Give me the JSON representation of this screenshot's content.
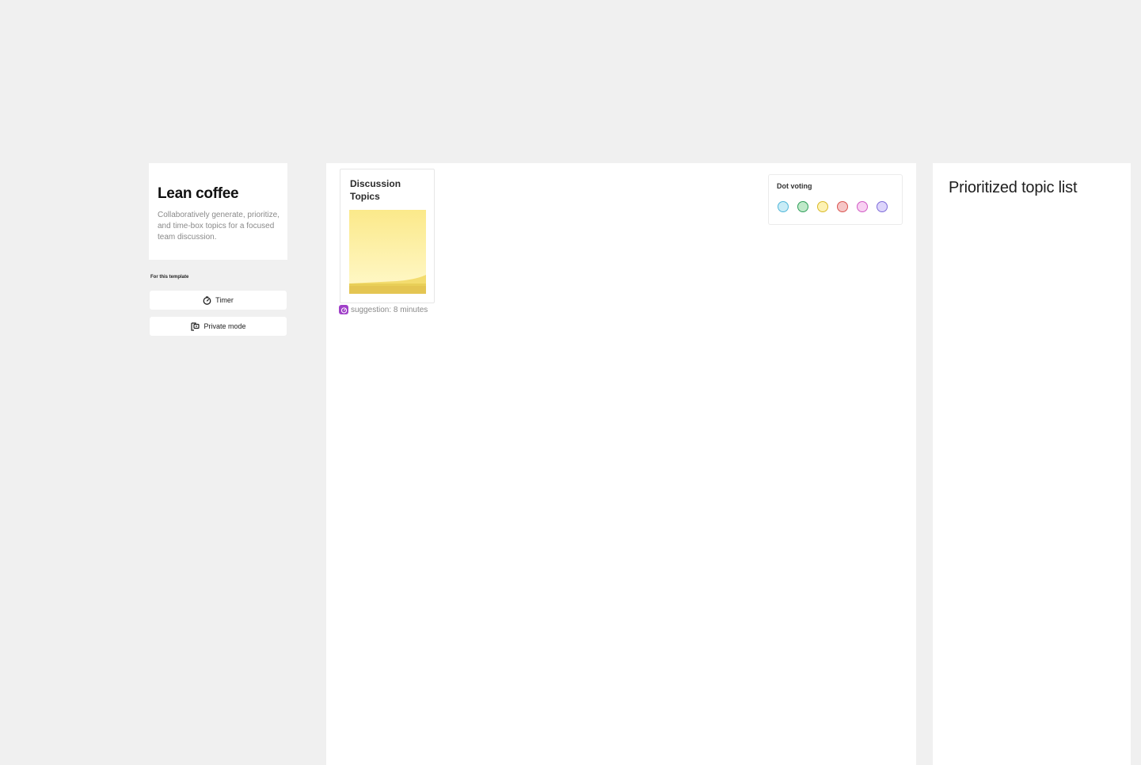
{
  "intro": {
    "title": "Lean coffee",
    "description": "Collaboratively generate, prioritize, and time-box topics for a focused team discussion."
  },
  "tools": {
    "heading": "For this template",
    "timer_label": "Timer",
    "private_mode_label": "Private mode"
  },
  "board": {
    "topics_title": "Discussion Topics",
    "suggestion_text": "suggestion: 8 minutes",
    "dot_voting": {
      "title": "Dot voting",
      "dots": [
        {
          "name": "blue",
          "fill": "#c9ecf7",
          "border": "#4fb6d8"
        },
        {
          "name": "green",
          "fill": "#bfe9c9",
          "border": "#2f9e5a"
        },
        {
          "name": "yellow",
          "fill": "#fdf2b3",
          "border": "#d9b928"
        },
        {
          "name": "red",
          "fill": "#f6c6c6",
          "border": "#d9534f"
        },
        {
          "name": "pink",
          "fill": "#f8d0f2",
          "border": "#d05ac4"
        },
        {
          "name": "purple",
          "fill": "#ddd5fb",
          "border": "#7d6bd8"
        }
      ]
    }
  },
  "priority": {
    "title": "Prioritized topic list"
  },
  "colors": {
    "canvas": "#f0f0f0",
    "sticky": "#fff3a8",
    "suggestion_icon": "#a040c8"
  },
  "icons": {
    "timer": "timer-icon",
    "private_mode": "private-mode-icon",
    "suggestion": "timer-icon"
  }
}
